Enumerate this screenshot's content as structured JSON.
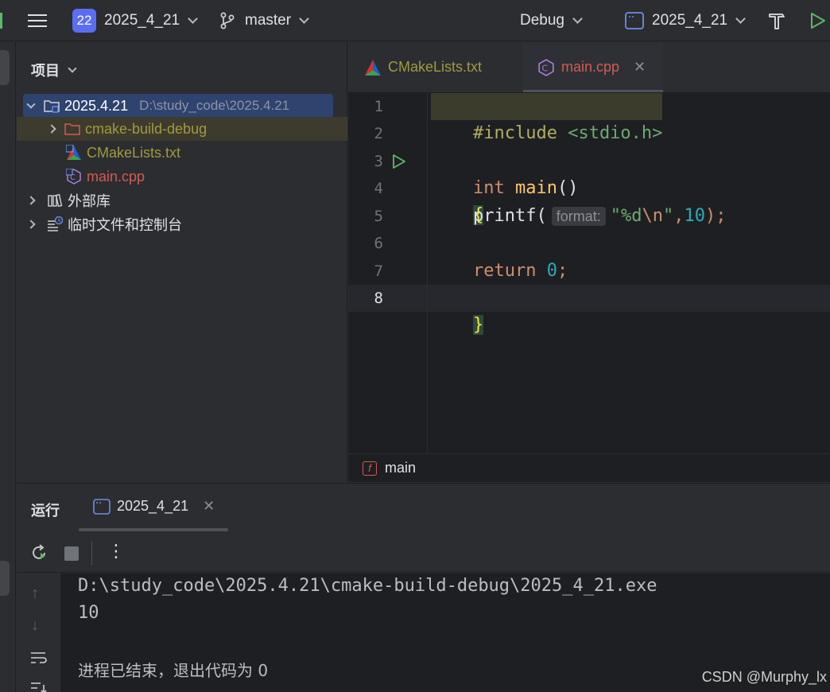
{
  "toolbar": {
    "project_badge": "22",
    "project_name": "2025_4_21",
    "branch": "master",
    "build_config": "Debug",
    "run_config": "2025_4_21"
  },
  "project_panel": {
    "title": "项目",
    "root_name": "2025.4.21",
    "root_path": "D:\\study_code\\2025.4.21",
    "items": [
      {
        "label": "cmake-build-debug"
      },
      {
        "label": "CMakeLists.txt"
      },
      {
        "label": "main.cpp"
      },
      {
        "label": "外部库"
      },
      {
        "label": "临时文件和控制台"
      }
    ]
  },
  "editor": {
    "tabs": [
      {
        "label": "CMakeLists.txt"
      },
      {
        "label": "main.cpp"
      }
    ],
    "line_numbers": [
      "1",
      "2",
      "3",
      "4",
      "5",
      "6",
      "7",
      "8"
    ],
    "code": {
      "l1_directive": "#include",
      "l1_header": "<stdio.h>",
      "l3_type": "int",
      "l3_name": "main",
      "l3_parens": "()",
      "l4_brace": "{",
      "l5_call": "printf(",
      "l5_hint": "format:",
      "l5_str_open": "\"%d",
      "l5_escape": "\\n",
      "l5_str_close": "\"",
      "l5_comma": ",",
      "l5_num": "10",
      "l5_end": ");",
      "l7_kw": "return",
      "l7_num": "0",
      "l7_end": ";",
      "l8_brace": "}"
    },
    "breadcrumb": "main",
    "breadcrumb_badge": "f"
  },
  "run_panel": {
    "title": "运行",
    "tab_label": "2025_4_21",
    "console_lines": [
      "D:\\study_code\\2025.4.21\\cmake-build-debug\\2025_4_21.exe",
      "10",
      "",
      "进程已结束，退出代码为 0"
    ]
  },
  "watermark": "CSDN @Murphy_lx",
  "colors": {
    "bg": "#2b2d30",
    "editor_bg": "#1e1f22",
    "keyword": "#cf8e6d",
    "string": "#6aab73",
    "number": "#2aacb8",
    "accent": "#5b6ef2",
    "modified_file": "#d45a52",
    "excluded_folder": "#a19a3f"
  }
}
